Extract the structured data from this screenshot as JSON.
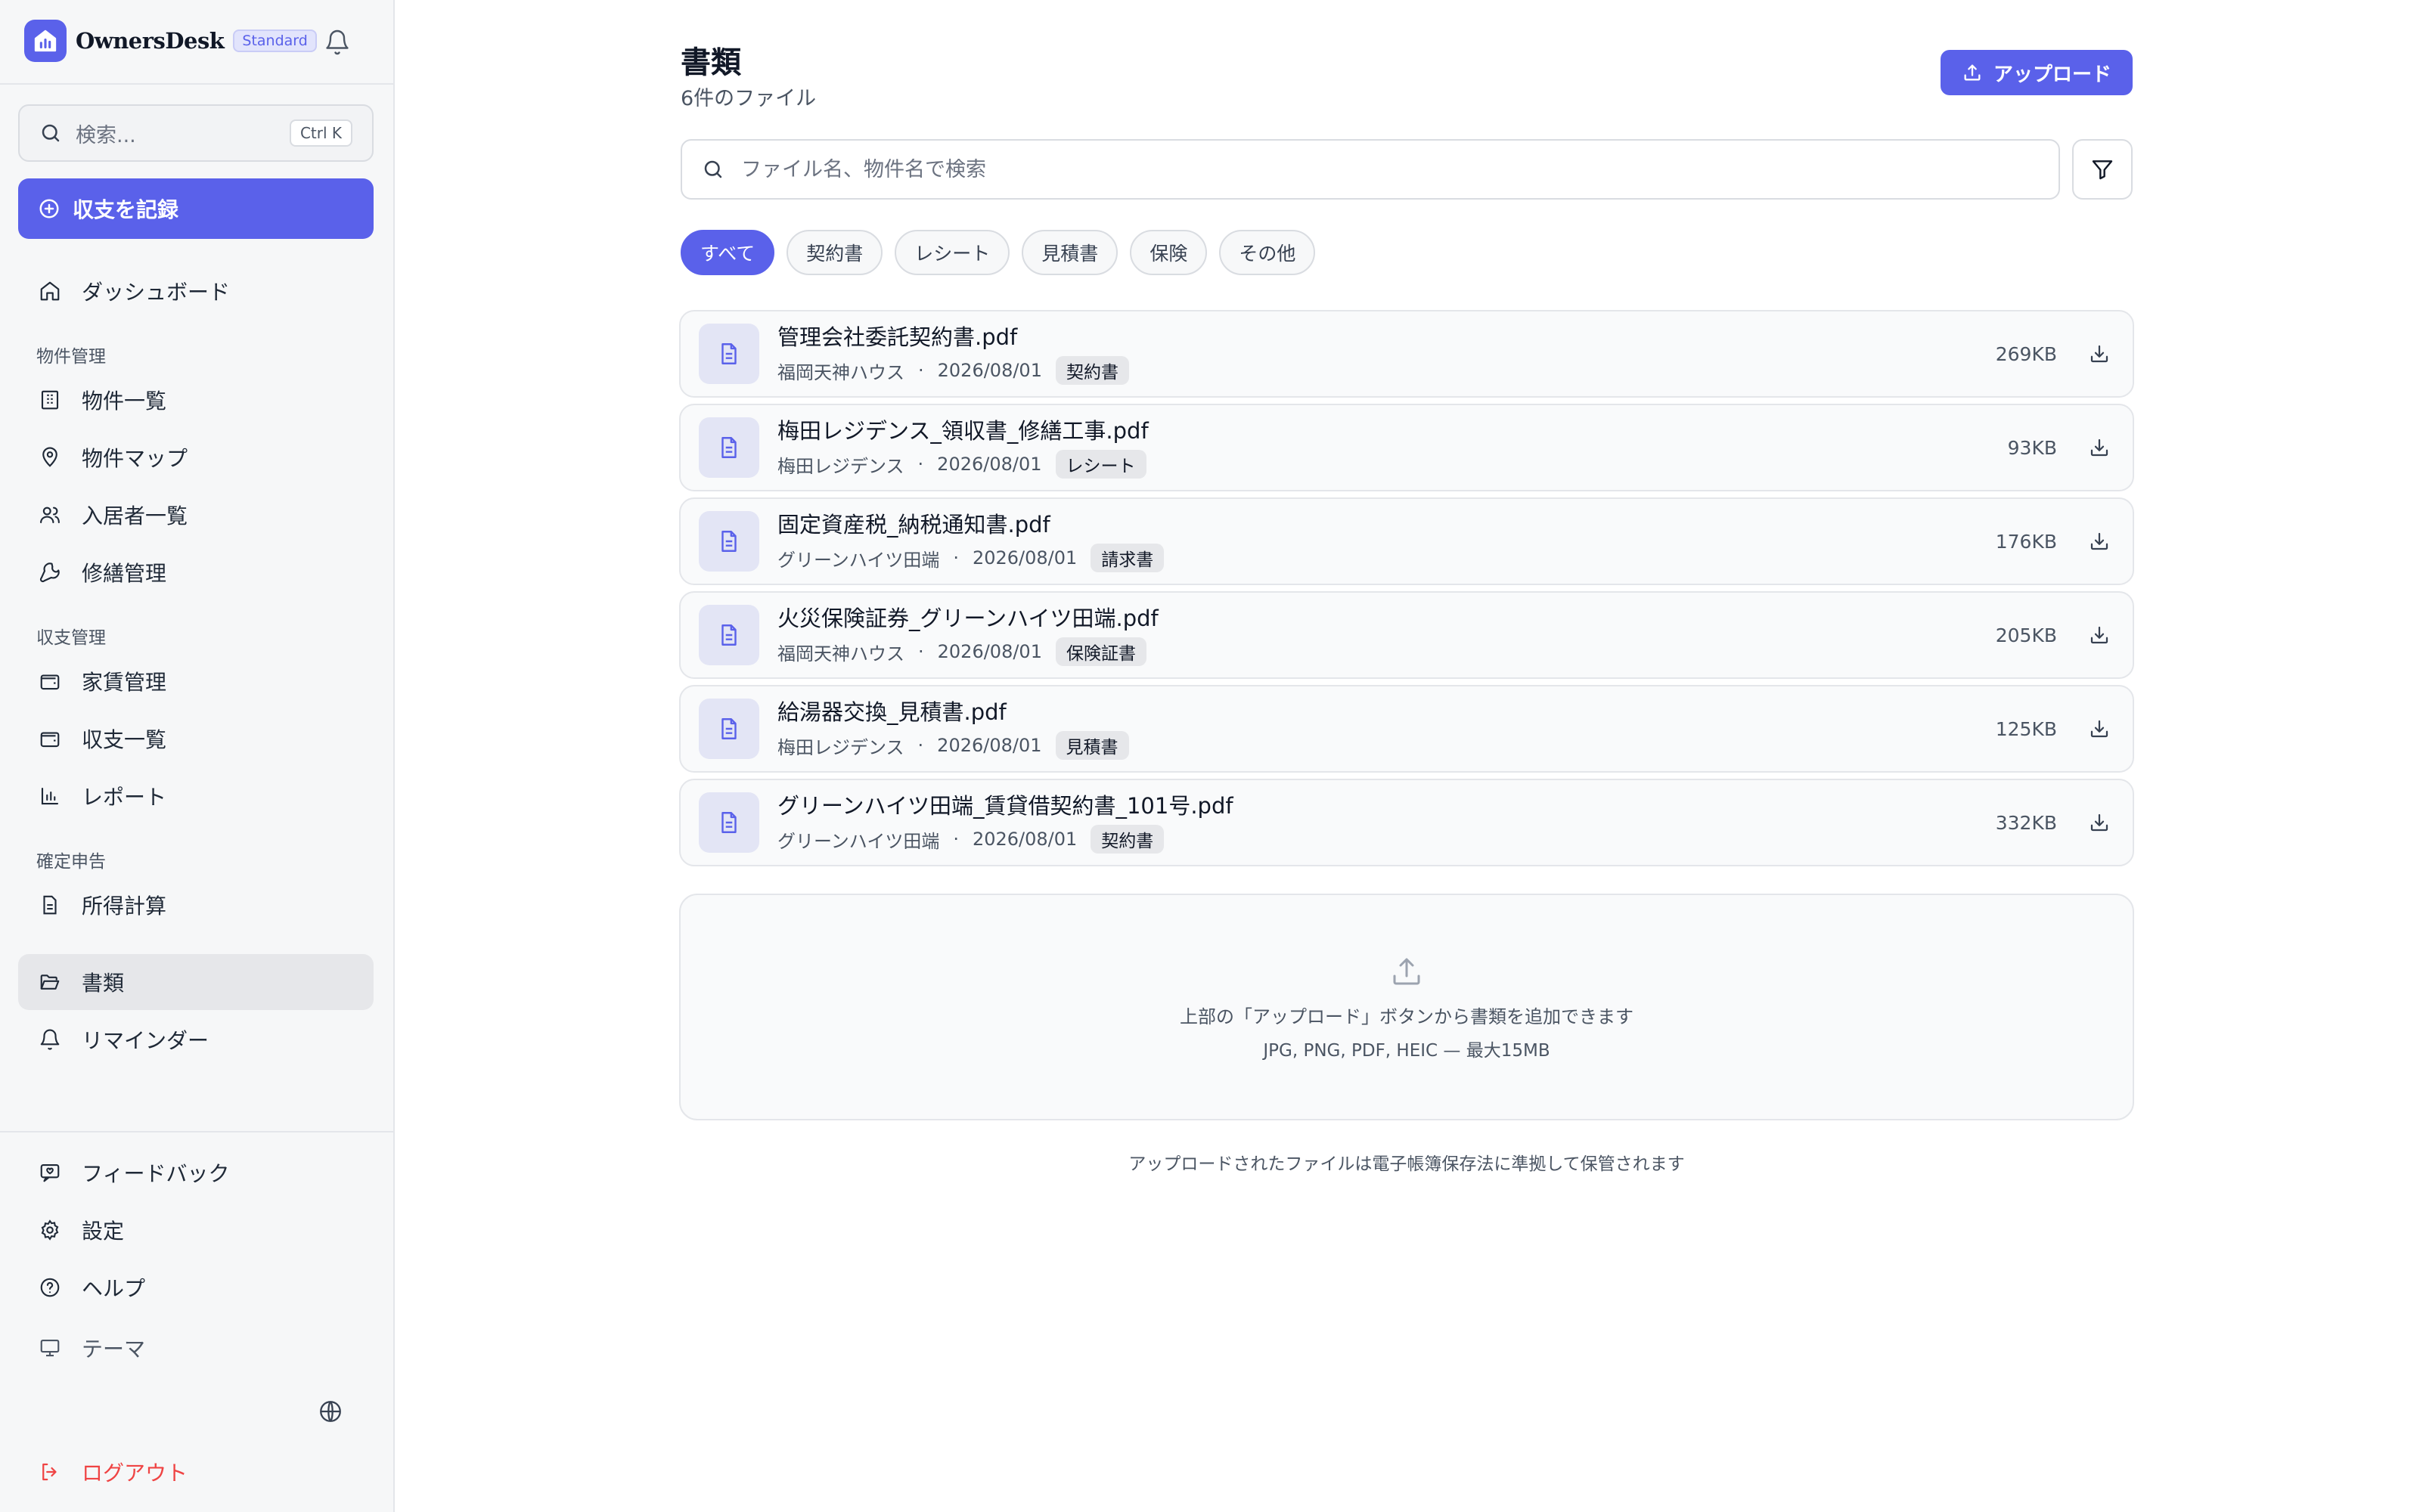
{
  "sidebar": {
    "brand": "OwnersDesk",
    "plan": "Standard",
    "search_placeholder": "検索...",
    "shortcut": "Ctrl K",
    "record_button": "収支を記録",
    "dashboard": "ダッシュボード",
    "groups": {
      "property": "物件管理",
      "finance": "収支管理",
      "tax": "確定申告"
    },
    "items": {
      "property_list": "物件一覧",
      "property_map": "物件マップ",
      "tenants": "入居者一覧",
      "repairs": "修繕管理",
      "rent": "家賃管理",
      "income_list": "収支一覧",
      "reports": "レポート",
      "income_calc": "所得計算",
      "documents": "書類",
      "reminders": "リマインダー",
      "feedback": "フィードバック",
      "settings": "設定",
      "help": "ヘルプ",
      "theme": "テーマ",
      "logout": "ログアウト"
    },
    "accent_color": "#5a61ea",
    "danger_color": "#ef4444"
  },
  "main": {
    "title": "書類",
    "subtitle": "6件のファイル",
    "upload_button": "アップロード",
    "search_placeholder": "ファイル名、物件名で検索",
    "filters": [
      "すべて",
      "契約書",
      "レシート",
      "見積書",
      "保険",
      "その他"
    ],
    "active_filter": "すべて",
    "files": [
      {
        "name": "管理会社委託契約書.pdf",
        "property": "福岡天神ハウス",
        "date": "2026/08/01",
        "tag": "契約書",
        "size": "269KB"
      },
      {
        "name": "梅田レジデンス_領収書_修繕工事.pdf",
        "property": "梅田レジデンス",
        "date": "2026/08/01",
        "tag": "レシート",
        "size": "93KB"
      },
      {
        "name": "固定資産税_納税通知書.pdf",
        "property": "グリーンハイツ田端",
        "date": "2026/08/01",
        "tag": "請求書",
        "size": "176KB"
      },
      {
        "name": "火災保険証券_グリーンハイツ田端.pdf",
        "property": "福岡天神ハウス",
        "date": "2026/08/01",
        "tag": "保険証書",
        "size": "205KB"
      },
      {
        "name": "給湯器交換_見積書.pdf",
        "property": "梅田レジデンス",
        "date": "2026/08/01",
        "tag": "見積書",
        "size": "125KB"
      },
      {
        "name": "グリーンハイツ田端_賃貸借契約書_101号.pdf",
        "property": "グリーンハイツ田端",
        "date": "2026/08/01",
        "tag": "契約書",
        "size": "332KB"
      }
    ],
    "dropzone_line1": "上部の「アップロード」ボタンから書類を追加できます",
    "dropzone_line2": "JPG, PNG, PDF, HEIC — 最大15MB",
    "footnote": "アップロードされたファイルは電子帳簿保存法に準拠して保管されます"
  }
}
